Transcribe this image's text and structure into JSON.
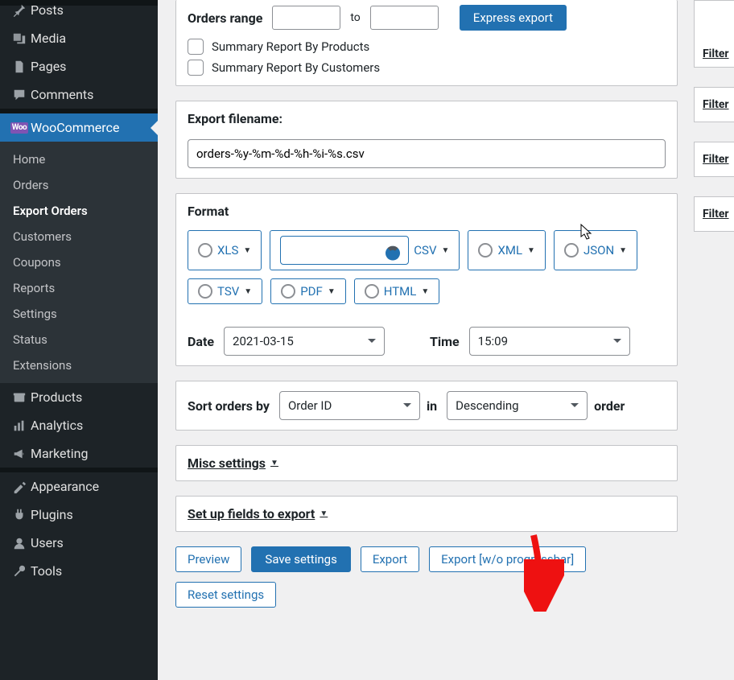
{
  "sidebar": {
    "posts": "Posts",
    "media": "Media",
    "pages": "Pages",
    "comments": "Comments",
    "woocommerce": "WooCommerce",
    "woo_badge": "Woo",
    "submenu": {
      "home": "Home",
      "orders": "Orders",
      "export_orders": "Export Orders",
      "customers": "Customers",
      "coupons": "Coupons",
      "reports": "Reports",
      "settings": "Settings",
      "status": "Status",
      "extensions": "Extensions"
    },
    "products": "Products",
    "analytics": "Analytics",
    "marketing": "Marketing",
    "appearance": "Appearance",
    "plugins": "Plugins",
    "users": "Users",
    "tools": "Tools"
  },
  "orders_range": {
    "label": "Orders range",
    "to": "to",
    "express_btn": "Express export"
  },
  "summary": {
    "by_products": "Summary Report By Products",
    "by_customers": "Summary Report By Customers"
  },
  "filename": {
    "label": "Export filename:",
    "value": "orders-%y-%m-%d-%h-%i-%s.csv"
  },
  "format": {
    "label": "Format",
    "xls": "XLS",
    "csv": "CSV",
    "xml": "XML",
    "json": "JSON",
    "tsv": "TSV",
    "pdf": "PDF",
    "html": "HTML",
    "date_label": "Date",
    "date_value": "2021-03-15",
    "time_label": "Time",
    "time_value": "15:09"
  },
  "sort": {
    "label": "Sort orders by",
    "field": "Order ID",
    "in": "in",
    "dir": "Descending",
    "order": "order"
  },
  "misc": "Misc settings",
  "fields": "Set up fields to export",
  "buttons": {
    "preview": "Preview",
    "save": "Save settings",
    "export": "Export",
    "export_wo": "Export [w/o progressbar]",
    "reset": "Reset settings"
  },
  "filter_stub": "Filter"
}
